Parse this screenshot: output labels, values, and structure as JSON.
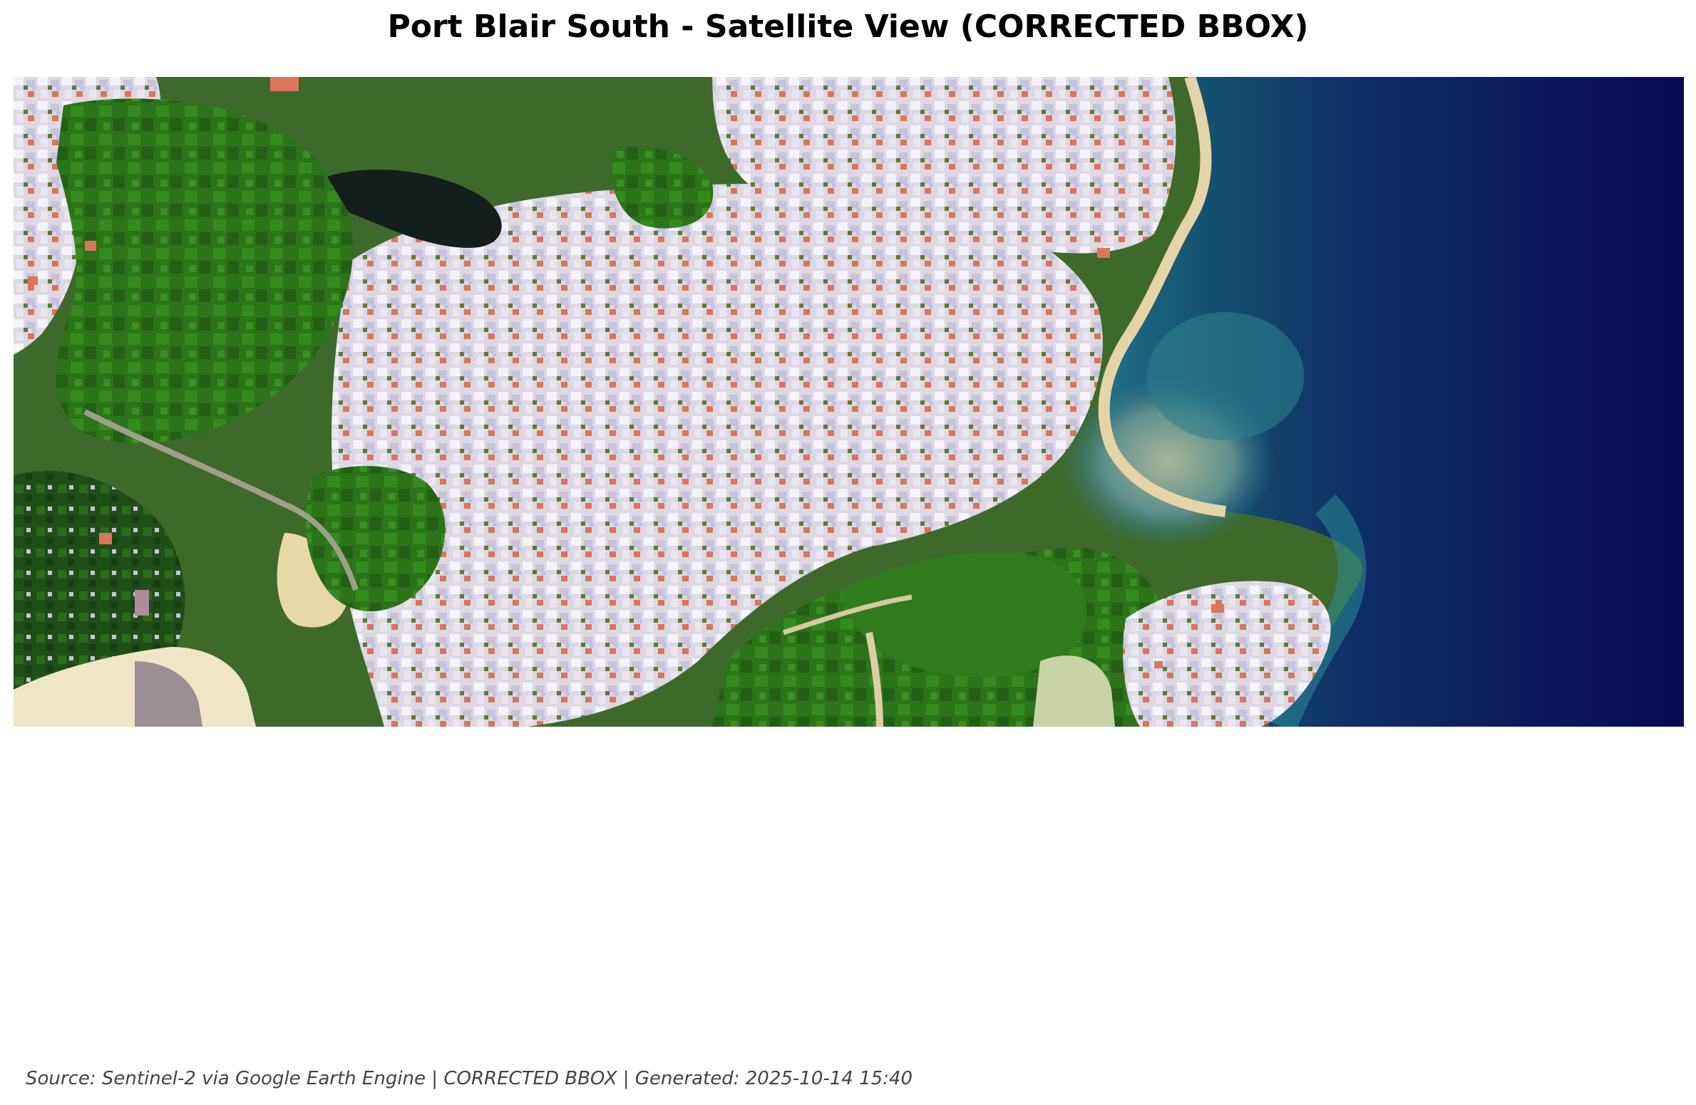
{
  "figure": {
    "title": "Port Blair South - Satellite View (CORRECTED BBOX)",
    "source_text": "Source: Sentinel-2 via Google Earth Engine | CORRECTED BBOX | Generated: 2025-10-14 15:40"
  },
  "image": {
    "kind": "satellite-rgb",
    "region": "Port Blair South",
    "land_cover": [
      "forest",
      "urban",
      "beach",
      "shallow-water",
      "deep-ocean"
    ],
    "colors": {
      "forest": "#2f7a1c",
      "forest_dark": "#1d4f12",
      "urban": "#e8e4ee",
      "roof_red": "#d9765c",
      "sand": "#e8d8a8",
      "shallow_water": "#2a7c8e",
      "turbid_water": "#7f9f8a",
      "deep_ocean": "#0a0c55",
      "salt_pan": "#9a8f95"
    }
  }
}
